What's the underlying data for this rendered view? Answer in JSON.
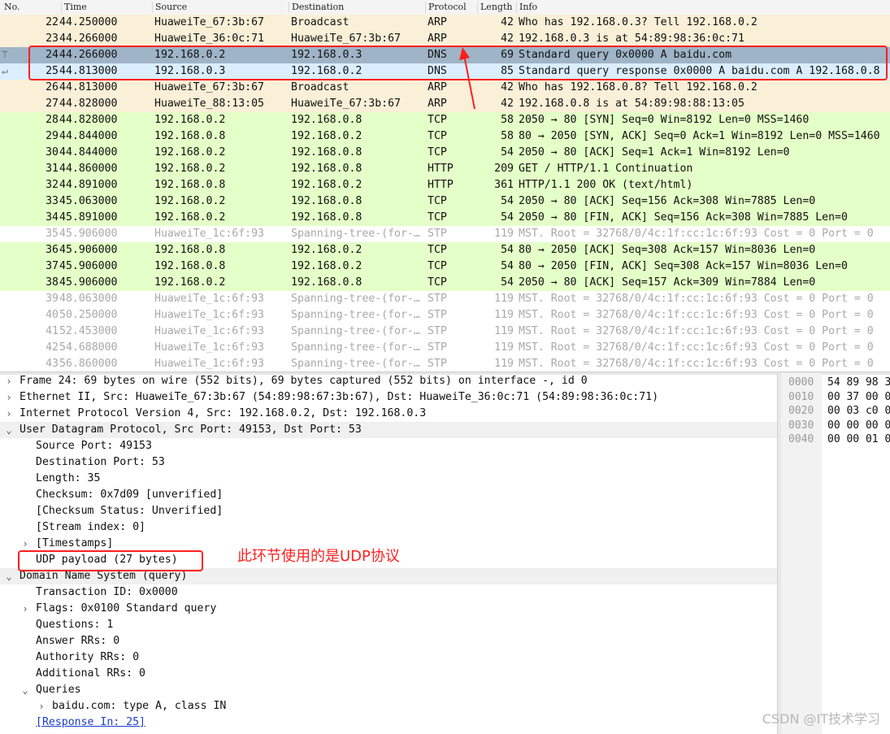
{
  "columns": {
    "no": "No.",
    "time": "Time",
    "source": "Source",
    "destination": "Destination",
    "protocol": "Protocol",
    "length": "Length",
    "info": "Info"
  },
  "packets": [
    {
      "no": "22",
      "time": "44.250000",
      "src": "HuaweiTe_67:3b:67",
      "dst": "Broadcast",
      "proto": "ARP",
      "len": "42",
      "info": "Who has 192.168.0.3? Tell 192.168.0.2",
      "style": "arp"
    },
    {
      "no": "23",
      "time": "44.266000",
      "src": "HuaweiTe_36:0c:71",
      "dst": "HuaweiTe_67:3b:67",
      "proto": "ARP",
      "len": "42",
      "info": "192.168.0.3 is at 54:89:98:36:0c:71",
      "style": "arp"
    },
    {
      "no": "24",
      "time": "44.266000",
      "src": "192.168.0.2",
      "dst": "192.168.0.3",
      "proto": "DNS",
      "len": "69",
      "info": "Standard query 0x0000 A baidu.com",
      "style": "sel"
    },
    {
      "no": "25",
      "time": "44.813000",
      "src": "192.168.0.3",
      "dst": "192.168.0.2",
      "proto": "DNS",
      "len": "85",
      "info": "Standard query response 0x0000 A baidu.com A 192.168.0.8",
      "style": "dns2"
    },
    {
      "no": "26",
      "time": "44.813000",
      "src": "HuaweiTe_67:3b:67",
      "dst": "Broadcast",
      "proto": "ARP",
      "len": "42",
      "info": "Who has 192.168.0.8? Tell 192.168.0.2",
      "style": "arp"
    },
    {
      "no": "27",
      "time": "44.828000",
      "src": "HuaweiTe_88:13:05",
      "dst": "HuaweiTe_67:3b:67",
      "proto": "ARP",
      "len": "42",
      "info": "192.168.0.8 is at 54:89:98:88:13:05",
      "style": "arp"
    },
    {
      "no": "28",
      "time": "44.828000",
      "src": "192.168.0.2",
      "dst": "192.168.0.8",
      "proto": "TCP",
      "len": "58",
      "info": "2050 → 80 [SYN] Seq=0 Win=8192 Len=0 MSS=1460",
      "style": "tcp"
    },
    {
      "no": "29",
      "time": "44.844000",
      "src": "192.168.0.8",
      "dst": "192.168.0.2",
      "proto": "TCP",
      "len": "58",
      "info": "80 → 2050 [SYN, ACK] Seq=0 Ack=1 Win=8192 Len=0 MSS=1460",
      "style": "tcp"
    },
    {
      "no": "30",
      "time": "44.844000",
      "src": "192.168.0.2",
      "dst": "192.168.0.8",
      "proto": "TCP",
      "len": "54",
      "info": "2050 → 80 [ACK] Seq=1 Ack=1 Win=8192 Len=0",
      "style": "tcp"
    },
    {
      "no": "31",
      "time": "44.860000",
      "src": "192.168.0.2",
      "dst": "192.168.0.8",
      "proto": "HTTP",
      "len": "209",
      "info": "GET / HTTP/1.1 Continuation",
      "style": "tcp"
    },
    {
      "no": "32",
      "time": "44.891000",
      "src": "192.168.0.8",
      "dst": "192.168.0.2",
      "proto": "HTTP",
      "len": "361",
      "info": "HTTP/1.1 200 OK  (text/html)",
      "style": "tcp"
    },
    {
      "no": "33",
      "time": "45.063000",
      "src": "192.168.0.2",
      "dst": "192.168.0.8",
      "proto": "TCP",
      "len": "54",
      "info": "2050 → 80 [ACK] Seq=156 Ack=308 Win=7885 Len=0",
      "style": "tcp"
    },
    {
      "no": "34",
      "time": "45.891000",
      "src": "192.168.0.2",
      "dst": "192.168.0.8",
      "proto": "TCP",
      "len": "54",
      "info": "2050 → 80 [FIN, ACK] Seq=156 Ack=308 Win=7885 Len=0",
      "style": "tcp"
    },
    {
      "no": "35",
      "time": "45.906000",
      "src": "HuaweiTe_1c:6f:93",
      "dst": "Spanning-tree-(for-…",
      "proto": "STP",
      "len": "119",
      "info": "MST. Root = 32768/0/4c:1f:cc:1c:6f:93  Cost = 0  Port = 0",
      "style": "stp"
    },
    {
      "no": "36",
      "time": "45.906000",
      "src": "192.168.0.8",
      "dst": "192.168.0.2",
      "proto": "TCP",
      "len": "54",
      "info": "80 → 2050 [ACK] Seq=308 Ack=157 Win=8036 Len=0",
      "style": "tcp"
    },
    {
      "no": "37",
      "time": "45.906000",
      "src": "192.168.0.8",
      "dst": "192.168.0.2",
      "proto": "TCP",
      "len": "54",
      "info": "80 → 2050 [FIN, ACK] Seq=308 Ack=157 Win=8036 Len=0",
      "style": "tcp"
    },
    {
      "no": "38",
      "time": "45.906000",
      "src": "192.168.0.2",
      "dst": "192.168.0.8",
      "proto": "TCP",
      "len": "54",
      "info": "2050 → 80 [ACK] Seq=157 Ack=309 Win=7884 Len=0",
      "style": "tcp"
    },
    {
      "no": "39",
      "time": "48.063000",
      "src": "HuaweiTe_1c:6f:93",
      "dst": "Spanning-tree-(for-…",
      "proto": "STP",
      "len": "119",
      "info": "MST. Root = 32768/0/4c:1f:cc:1c:6f:93  Cost = 0  Port = 0",
      "style": "stp"
    },
    {
      "no": "40",
      "time": "50.250000",
      "src": "HuaweiTe_1c:6f:93",
      "dst": "Spanning-tree-(for-…",
      "proto": "STP",
      "len": "119",
      "info": "MST. Root = 32768/0/4c:1f:cc:1c:6f:93  Cost = 0  Port = 0",
      "style": "stp"
    },
    {
      "no": "41",
      "time": "52.453000",
      "src": "HuaweiTe_1c:6f:93",
      "dst": "Spanning-tree-(for-…",
      "proto": "STP",
      "len": "119",
      "info": "MST. Root = 32768/0/4c:1f:cc:1c:6f:93  Cost = 0  Port = 0",
      "style": "stp"
    },
    {
      "no": "42",
      "time": "54.688000",
      "src": "HuaweiTe_1c:6f:93",
      "dst": "Spanning-tree-(for-…",
      "proto": "STP",
      "len": "119",
      "info": "MST. Root = 32768/0/4c:1f:cc:1c:6f:93  Cost = 0  Port = 0",
      "style": "stp"
    },
    {
      "no": "43",
      "time": "56.860000",
      "src": "HuaweiTe_1c:6f:93",
      "dst": "Spanning-tree-(for-…",
      "proto": "STP",
      "len": "119",
      "info": "MST. Root = 32768/0/4c:1f:cc:1c:6f:93  Cost = 0  Port = 0",
      "style": "stp"
    }
  ],
  "details": [
    {
      "arrow": "›",
      "indent": 0,
      "text": "Frame 24: 69 bytes on wire (552 bits), 69 bytes captured (552 bits) on interface -, id 0"
    },
    {
      "arrow": "›",
      "indent": 0,
      "text": "Ethernet II, Src: HuaweiTe_67:3b:67 (54:89:98:67:3b:67), Dst: HuaweiTe_36:0c:71 (54:89:98:36:0c:71)"
    },
    {
      "arrow": "›",
      "indent": 0,
      "text": "Internet Protocol Version 4, Src: 192.168.0.2, Dst: 192.168.0.3"
    },
    {
      "arrow": "⌄",
      "indent": 0,
      "text": "User Datagram Protocol, Src Port: 49153, Dst Port: 53",
      "sel": true
    },
    {
      "arrow": "",
      "indent": 1,
      "text": "Source Port: 49153"
    },
    {
      "arrow": "",
      "indent": 1,
      "text": "Destination Port: 53"
    },
    {
      "arrow": "",
      "indent": 1,
      "text": "Length: 35"
    },
    {
      "arrow": "",
      "indent": 1,
      "text": "Checksum: 0x7d09 [unverified]"
    },
    {
      "arrow": "",
      "indent": 1,
      "text": "[Checksum Status: Unverified]"
    },
    {
      "arrow": "",
      "indent": 1,
      "text": "[Stream index: 0]"
    },
    {
      "arrow": "›",
      "indent": 1,
      "text": "[Timestamps]"
    },
    {
      "arrow": "",
      "indent": 1,
      "text": "UDP payload (27 bytes)"
    },
    {
      "arrow": "⌄",
      "indent": 0,
      "text": "Domain Name System (query)",
      "sel": true
    },
    {
      "arrow": "",
      "indent": 1,
      "text": "Transaction ID: 0x0000"
    },
    {
      "arrow": "›",
      "indent": 1,
      "text": "Flags: 0x0100 Standard query"
    },
    {
      "arrow": "",
      "indent": 1,
      "text": "Questions: 1"
    },
    {
      "arrow": "",
      "indent": 1,
      "text": "Answer RRs: 0"
    },
    {
      "arrow": "",
      "indent": 1,
      "text": "Authority RRs: 0"
    },
    {
      "arrow": "",
      "indent": 1,
      "text": "Additional RRs: 0"
    },
    {
      "arrow": "⌄",
      "indent": 1,
      "text": "Queries"
    },
    {
      "arrow": "›",
      "indent": 2,
      "text": "baidu.com: type A, class IN"
    },
    {
      "arrow": "",
      "indent": 1,
      "text": "[Response In: 25]",
      "link": true
    }
  ],
  "bytes": [
    {
      "offset": "0000",
      "hex": "54 89 98 3"
    },
    {
      "offset": "0010",
      "hex": "00 37 00 0"
    },
    {
      "offset": "0020",
      "hex": "00 03 c0 0"
    },
    {
      "offset": "0030",
      "hex": "00 00 00 0"
    },
    {
      "offset": "0040",
      "hex": "00 00 01 0"
    }
  ],
  "annotation": {
    "note": "此环节使用的是UDP协议",
    "color": "#ff1f1f"
  },
  "watermark": "CSDN @IT技术学习",
  "colors": {
    "arp": "#faf0d7",
    "tcp": "#e4ffc7",
    "selected": "#9fb4c6",
    "response": "#daeeff"
  }
}
